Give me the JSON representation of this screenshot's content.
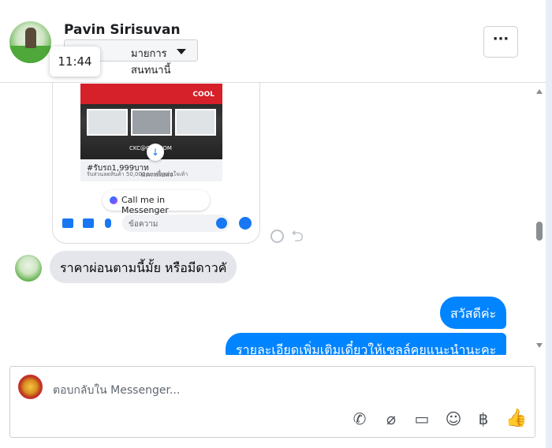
{
  "header": {
    "name": "Pavin Sirisuvan",
    "dropdown_label": "มายการสนทนานี้",
    "timestamp_tooltip": "11:44",
    "more_label": "···"
  },
  "shared_card": {
    "ad_banner": "COOL",
    "ad_brand": "CKC@CAR.COM",
    "ad_title": "#รับรถ1,999บาท",
    "ad_subtitle": "รับส่วนลดสินค้า 50,000 บาท หลอนใจเท้า",
    "tap_to_send": "แตะเพื่อส่ง",
    "cta_button": "Call me in Messenger",
    "mini_input_placeholder": "ข้อความ"
  },
  "messages": [
    {
      "sender": "incoming",
      "text": "ราคาผ่อนตามนี้มั้ย หรือมีดาวคั"
    },
    {
      "sender": "outgoing",
      "text": "สวัสดีค่ะ"
    },
    {
      "sender": "outgoing",
      "text": "รายละเอียดเพิ่มเติมเดี๋ยวให้เซลล์คุยแนะนำนะคะ"
    }
  ],
  "composer": {
    "placeholder": "ตอบกลับใน Messenger...",
    "tools": [
      "call-add-icon",
      "attachment-icon",
      "saved-reply-icon",
      "emoji-icon",
      "baht-icon",
      "like-icon"
    ],
    "baht_symbol": "฿"
  },
  "colors": {
    "outgoing_bubble": "#0084ff",
    "incoming_bubble": "#e4e6eb",
    "accent": "#1877f2"
  }
}
